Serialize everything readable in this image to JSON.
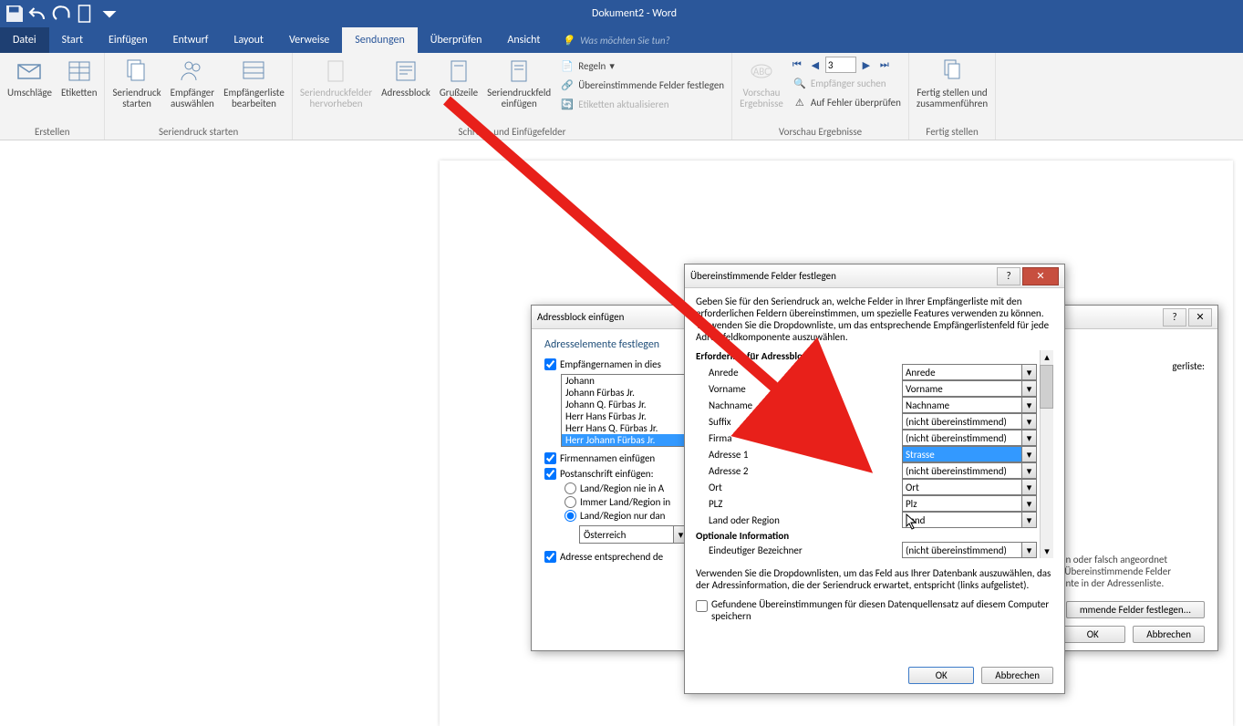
{
  "app": {
    "title": "Dokument2 - Word",
    "tellme": "Was möchten Sie tun?"
  },
  "tabs": {
    "datei": "Datei",
    "start": "Start",
    "einfuegen": "Einfügen",
    "entwurf": "Entwurf",
    "layout": "Layout",
    "verweise": "Verweise",
    "sendungen": "Sendungen",
    "ueberpruefen": "Überprüfen",
    "ansicht": "Ansicht"
  },
  "ribbon": {
    "erstellen": {
      "label": "Erstellen",
      "umschlaege": "Umschläge",
      "etiketten": "Etiketten"
    },
    "starten": {
      "label": "Seriendruck starten",
      "seriendruck_starten": "Seriendruck\nstarten",
      "empfaenger_auswaehlen": "Empfänger\nauswählen",
      "empfaengerliste_bearbeiten": "Empfängerliste\nbearbeiten"
    },
    "schreib": {
      "label": "Schreib- und Einfügefelder",
      "seriendruckfelder_hervorheben": "Seriendruckfelder\nhervorheben",
      "adressblock": "Adressblock",
      "grusszeile": "Grußzeile",
      "seriendruckfeld_einfuegen": "Seriendruckfeld\neinfügen",
      "regeln": "Regeln",
      "uebereinstimmende": "Übereinstimmende Felder festlegen",
      "etiketten_aktualisieren": "Etiketten aktualisieren"
    },
    "vorschau": {
      "label": "Vorschau Ergebnisse",
      "vorschau_ergebnisse": "Vorschau\nErgebnisse",
      "record": "3",
      "empfaenger_suchen": "Empfänger suchen",
      "fehler": "Auf Fehler überprüfen"
    },
    "fertig": {
      "label": "Fertig stellen",
      "fertig_stellen": "Fertig stellen und\nzusammenführen"
    }
  },
  "dlg1": {
    "title": "Adressblock einfügen",
    "section1": "Adresselemente festlegen",
    "check_empfaenger": "Empfängernamen in dies",
    "names": [
      "Johann",
      "Johann Fürbas Jr.",
      "Johann Q. Fürbas Jr.",
      "Herr Hans Fürbas Jr.",
      "Herr Hans Q. Fürbas Jr.",
      "Herr Johann Fürbas Jr."
    ],
    "check_firma": "Firmennamen einfügen",
    "check_post": "Postanschrift einfügen:",
    "radio1": "Land/Region nie in A",
    "radio2": "Immer Land/Region in",
    "radio3": "Land/Region nur dan",
    "country": "Österreich",
    "check_adresse": "Adresse entsprechend de",
    "right_header": "gerliste:",
    "hint1": "en oder falsch angeordnet",
    "hint2": "\"Übereinstimmende Felder",
    "hint3": "ente in der Adressenliste.",
    "btn_match": "mmende Felder festlegen...",
    "ok": "OK",
    "cancel": "Abbrechen"
  },
  "dlg2": {
    "title": "Übereinstimmende Felder festlegen",
    "intro": "Geben Sie für den Seriendruck an, welche Felder in Ihrer Empfängerliste mit den erforderlichen Feldern übereinstimmen, um spezielle Features verwenden zu können. Verwenden Sie die Dropdownliste, um das entsprechende Empfängerlistenfeld für jede Adressfeldkomponente auszuwählen.",
    "required_header": "Erforderlich für Adressblock",
    "fields": [
      {
        "label": "Anrede",
        "value": "Anrede",
        "hl": false
      },
      {
        "label": "Vorname",
        "value": "Vorname",
        "hl": false
      },
      {
        "label": "Nachname",
        "value": "Nachname",
        "hl": false
      },
      {
        "label": "Suffix",
        "value": "(nicht übereinstimmend)",
        "hl": false
      },
      {
        "label": "Firma",
        "value": "(nicht übereinstimmend)",
        "hl": false
      },
      {
        "label": "Adresse 1",
        "value": "Strasse",
        "hl": true
      },
      {
        "label": "Adresse 2",
        "value": "(nicht übereinstimmend)",
        "hl": false
      },
      {
        "label": "Ort",
        "value": "Ort",
        "hl": false
      },
      {
        "label": "PLZ",
        "value": "Plz",
        "hl": false
      },
      {
        "label": "Land oder Region",
        "value": "Land",
        "hl": false
      }
    ],
    "optional_header": "Optionale Information",
    "opt_field": {
      "label": "Eindeutiger Bezeichner",
      "value": "(nicht übereinstimmend)"
    },
    "hint2": "Verwenden Sie die Dropdownlisten, um das Feld aus Ihrer Datenbank auszuwählen, das der Adressinformation, die der Seriendruck erwartet, entspricht (links aufgelistet).",
    "check_save": "Gefundene Übereinstimmungen für diesen Datenquellensatz auf diesem Computer speichern",
    "ok": "OK",
    "cancel": "Abbrechen"
  }
}
